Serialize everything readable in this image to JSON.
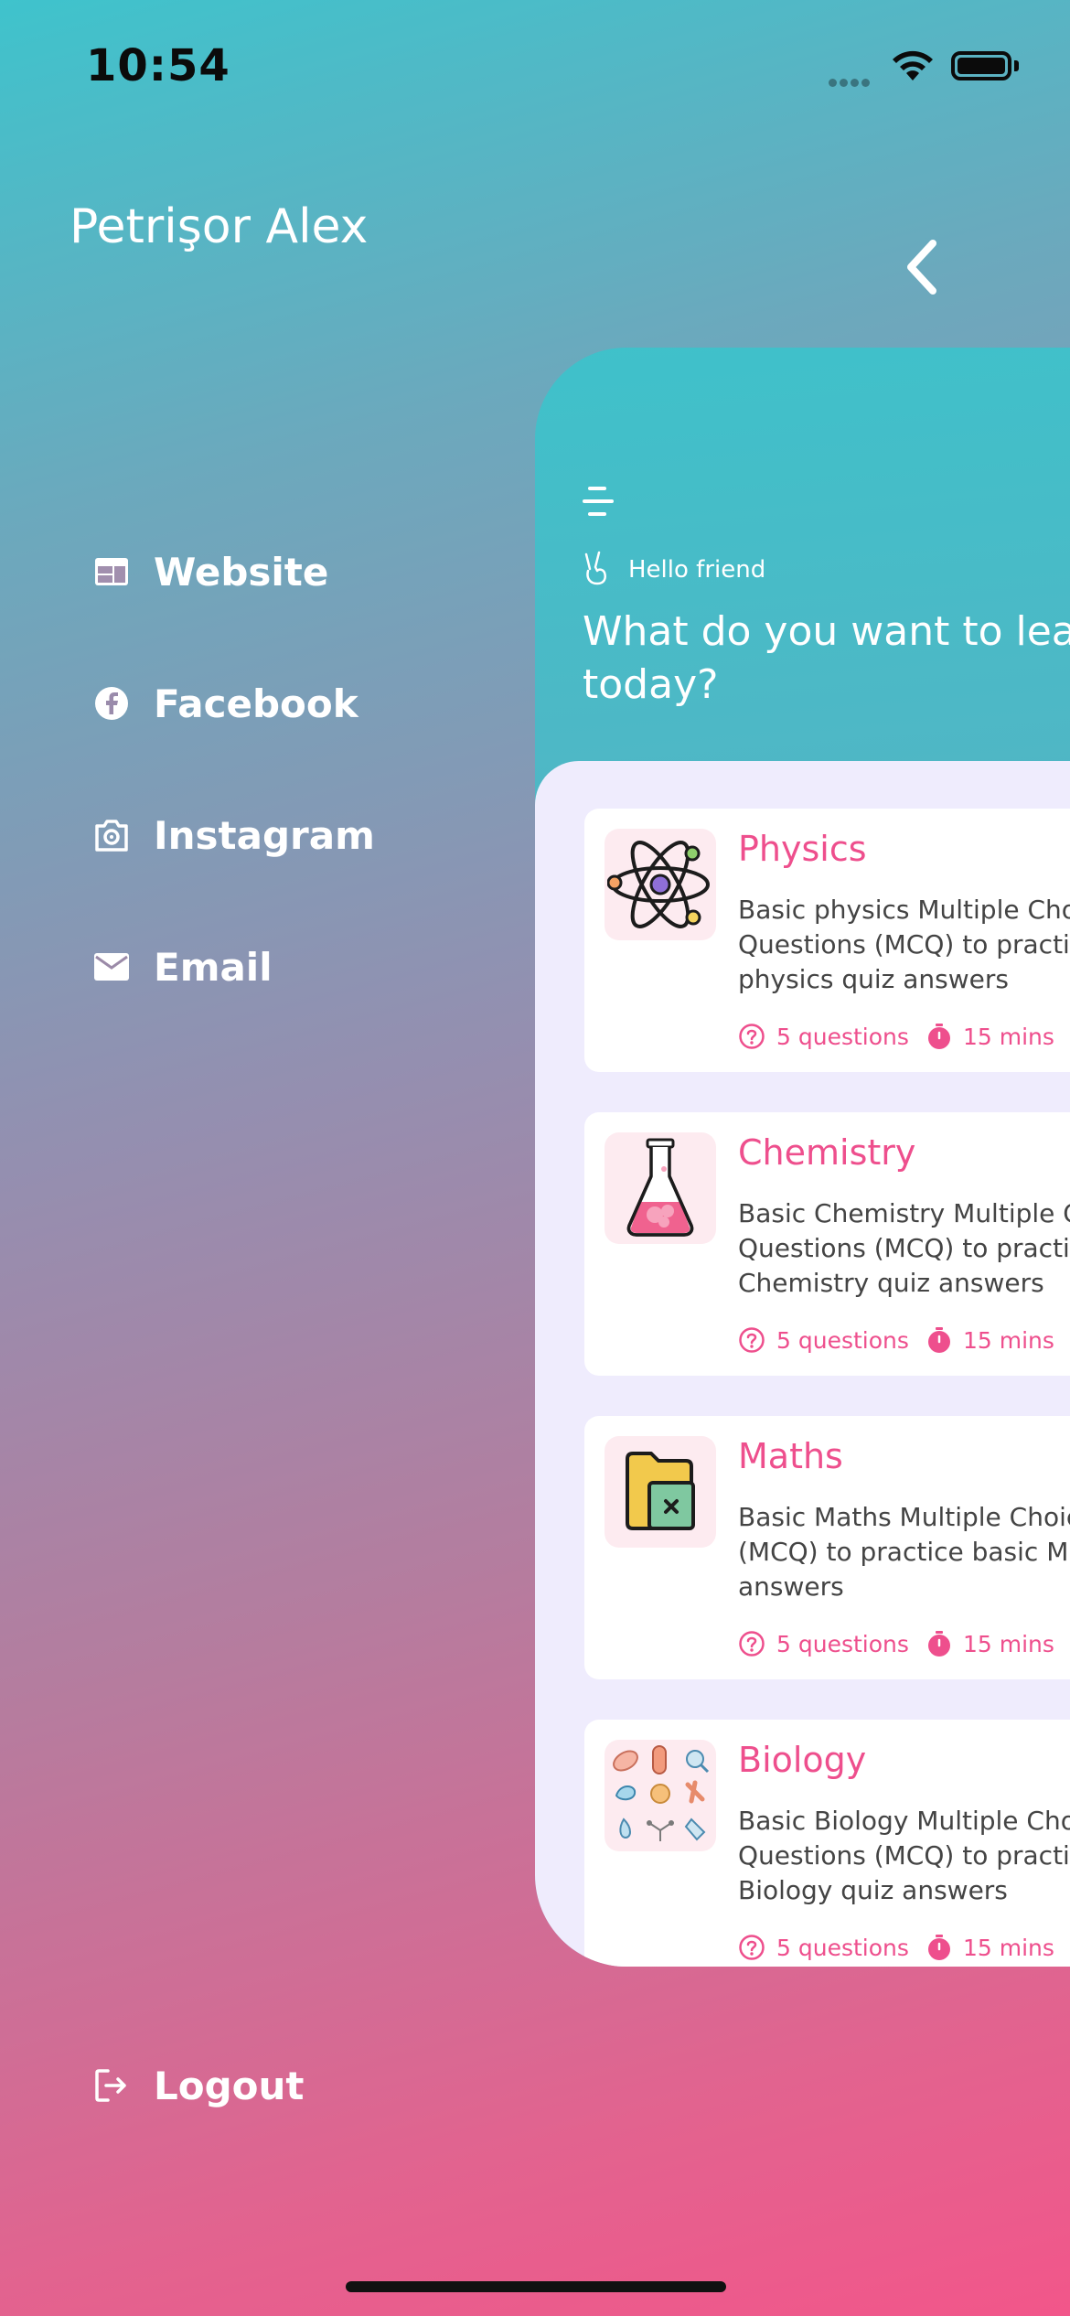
{
  "status_bar": {
    "time": "10:54"
  },
  "drawer": {
    "user_name": "Petrişor Alex",
    "items": [
      {
        "label": "Website",
        "icon": "website-icon"
      },
      {
        "label": "Facebook",
        "icon": "facebook-icon"
      },
      {
        "label": "Instagram",
        "icon": "instagram-icon"
      },
      {
        "label": "Email",
        "icon": "email-icon"
      }
    ],
    "logout_label": "Logout"
  },
  "main": {
    "greeting": "Hello friend",
    "question_line1": "What do you want to lear",
    "question_line2": "today?",
    "quizzes": [
      {
        "title": "Physics",
        "desc": [
          "Basic physics Multiple Choi",
          "Questions (MCQ) to practic",
          "physics quiz answers"
        ],
        "questions": "5 questions",
        "duration": "15 mins",
        "icon": "atom-icon"
      },
      {
        "title": "Chemistry",
        "desc": [
          "Basic Chemistry Multiple Ch",
          "Questions (MCQ) to practic",
          "Chemistry quiz answers"
        ],
        "questions": "5 questions",
        "duration": "15 mins",
        "icon": "flask-icon"
      },
      {
        "title": "Maths",
        "desc": [
          "Basic Maths Multiple Choice",
          "(MCQ) to practice basic Ma",
          "answers"
        ],
        "questions": "5 questions",
        "duration": "15 mins",
        "icon": "math-folder-icon"
      },
      {
        "title": "Biology",
        "desc": [
          "Basic Biology Multiple Choi",
          "Questions (MCQ) to practic",
          "Biology quiz answers"
        ],
        "questions": "5 questions",
        "duration": "15 mins",
        "icon": "biology-cells-icon"
      }
    ]
  },
  "colors": {
    "accent": "#ee4f8d",
    "teal": "#3fc3cc",
    "list_bg": "#efecfd"
  }
}
